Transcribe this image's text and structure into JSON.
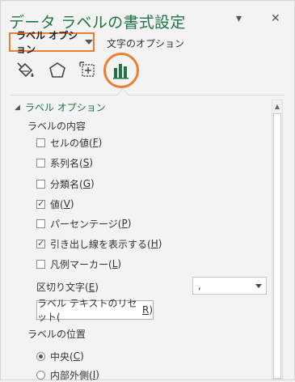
{
  "pane": {
    "title": "データ ラベルの書式設定",
    "pin_glyph": "▾",
    "close_glyph": "✕"
  },
  "tabs": {
    "label_options": "ラベル オプション",
    "text_options": "文字のオプション"
  },
  "icons": [
    "fill-line-icon",
    "effects-pentagon-icon",
    "size-properties-icon",
    "label-options-chart-icon"
  ],
  "accent_color": "#217346",
  "highlight_color": "#ed7d31",
  "section": {
    "title": "ラベル オプション",
    "contents_label": "ラベルの内容",
    "checkboxes": [
      {
        "text": "セルの値(",
        "key": "F",
        "close": ")",
        "checked": false
      },
      {
        "text": "系列名(",
        "key": "S",
        "close": ")",
        "checked": false
      },
      {
        "text": "分類名(",
        "key": "G",
        "close": ")",
        "checked": false
      },
      {
        "text": "値(",
        "key": "V",
        "close": ")",
        "checked": true
      },
      {
        "text": "パーセンテージ(",
        "key": "P",
        "close": ")",
        "checked": false
      },
      {
        "text": "引き出し線を表示する(",
        "key": "H",
        "close": ")",
        "checked": true
      },
      {
        "text": "凡例マーカー(",
        "key": "L",
        "close": ")",
        "checked": false
      }
    ],
    "separator": {
      "text": "区切り文字(",
      "key": "E",
      "close": ")",
      "value": ","
    },
    "reset": {
      "text": "ラベル テキストのリセット(",
      "key": "R",
      "close": ")"
    },
    "position_label": "ラベルの位置",
    "radios": [
      {
        "text": "中央(",
        "key": "C",
        "close": ")",
        "selected": true
      },
      {
        "text": "内部外側(",
        "key": "I",
        "close": ")",
        "selected": false
      }
    ]
  }
}
